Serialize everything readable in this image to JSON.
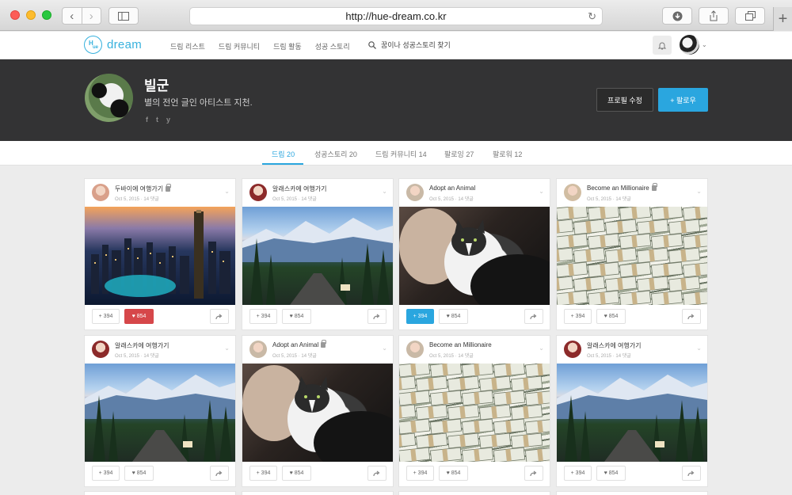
{
  "browser": {
    "url": "http://hue-dream.co.kr"
  },
  "site": {
    "logo_text": "dream",
    "logo_mark_h": "H",
    "logo_mark_ue": "ue",
    "nav": [
      "드림 리스트",
      "드림 커뮤니티",
      "드림 활동",
      "성공 스토리"
    ],
    "search_placeholder": "꿈이나 성공스토리 찾기"
  },
  "profile": {
    "name": "빌군",
    "bio": "별의 전언 글인 아티스트 지천.",
    "social": [
      "f",
      "t",
      "y"
    ],
    "edit_label": "프로필 수정",
    "follow_label": "+ 팔로우"
  },
  "tabs": [
    {
      "label": "드림 20",
      "active": true
    },
    {
      "label": "성공스토리 20",
      "active": false
    },
    {
      "label": "드림 커뮤니티 14",
      "active": false
    },
    {
      "label": "팔로잉 27",
      "active": false
    },
    {
      "label": "팔로워 12",
      "active": false
    }
  ],
  "cards": [
    {
      "title": "두바이에 여행가기",
      "locked": true,
      "meta": "Oct 5, 2015 · 14 댓글",
      "scene": "dubai",
      "adds": "+ 394",
      "likes": "♥ 854",
      "state": "liked",
      "avatar_color": "#d9a08a"
    },
    {
      "title": "알래스카에 여행가기",
      "locked": false,
      "meta": "Oct 5, 2015 · 14 댓글",
      "scene": "alaska",
      "adds": "+ 394",
      "likes": "♥ 854",
      "state": "",
      "avatar_color": "#8c2a2a"
    },
    {
      "title": "Adopt an Animal",
      "locked": false,
      "meta": "Oct 5, 2015 · 14 댓글",
      "scene": "cat",
      "adds": "+ 394",
      "likes": "♥ 854",
      "state": "added",
      "avatar_color": "#c9b9a6"
    },
    {
      "title": "Become an Millionaire",
      "locked": true,
      "meta": "Oct 5, 2015 · 14 댓글",
      "scene": "money",
      "adds": "+ 394",
      "likes": "♥ 854",
      "state": "",
      "avatar_color": "#d1bda2"
    },
    {
      "title": "알래스카에 여행가기",
      "locked": false,
      "meta": "Oct 5, 2015 · 14 댓글",
      "scene": "alaska",
      "adds": "+ 394",
      "likes": "♥ 854",
      "state": "",
      "avatar_color": "#8c2a2a"
    },
    {
      "title": "Adopt an Animal",
      "locked": true,
      "meta": "Oct 5, 2015 · 14 댓글",
      "scene": "cat",
      "adds": "+ 394",
      "likes": "♥ 854",
      "state": "",
      "avatar_color": "#c9b9a6"
    },
    {
      "title": "Become an Millionaire",
      "locked": false,
      "meta": "Oct 5, 2015 · 14 댓글",
      "scene": "money",
      "adds": "+ 394",
      "likes": "♥ 854",
      "state": "",
      "avatar_color": "#c9b9a6"
    },
    {
      "title": "알래스카에 여행가기",
      "locked": false,
      "meta": "Oct 5, 2015 · 14 댓글",
      "scene": "alaska",
      "adds": "+ 394",
      "likes": "♥ 854",
      "state": "",
      "avatar_color": "#8c2a2a"
    }
  ],
  "colors": {
    "accent": "#2aa6df",
    "liked": "#d6474a",
    "banner": "#333334"
  }
}
